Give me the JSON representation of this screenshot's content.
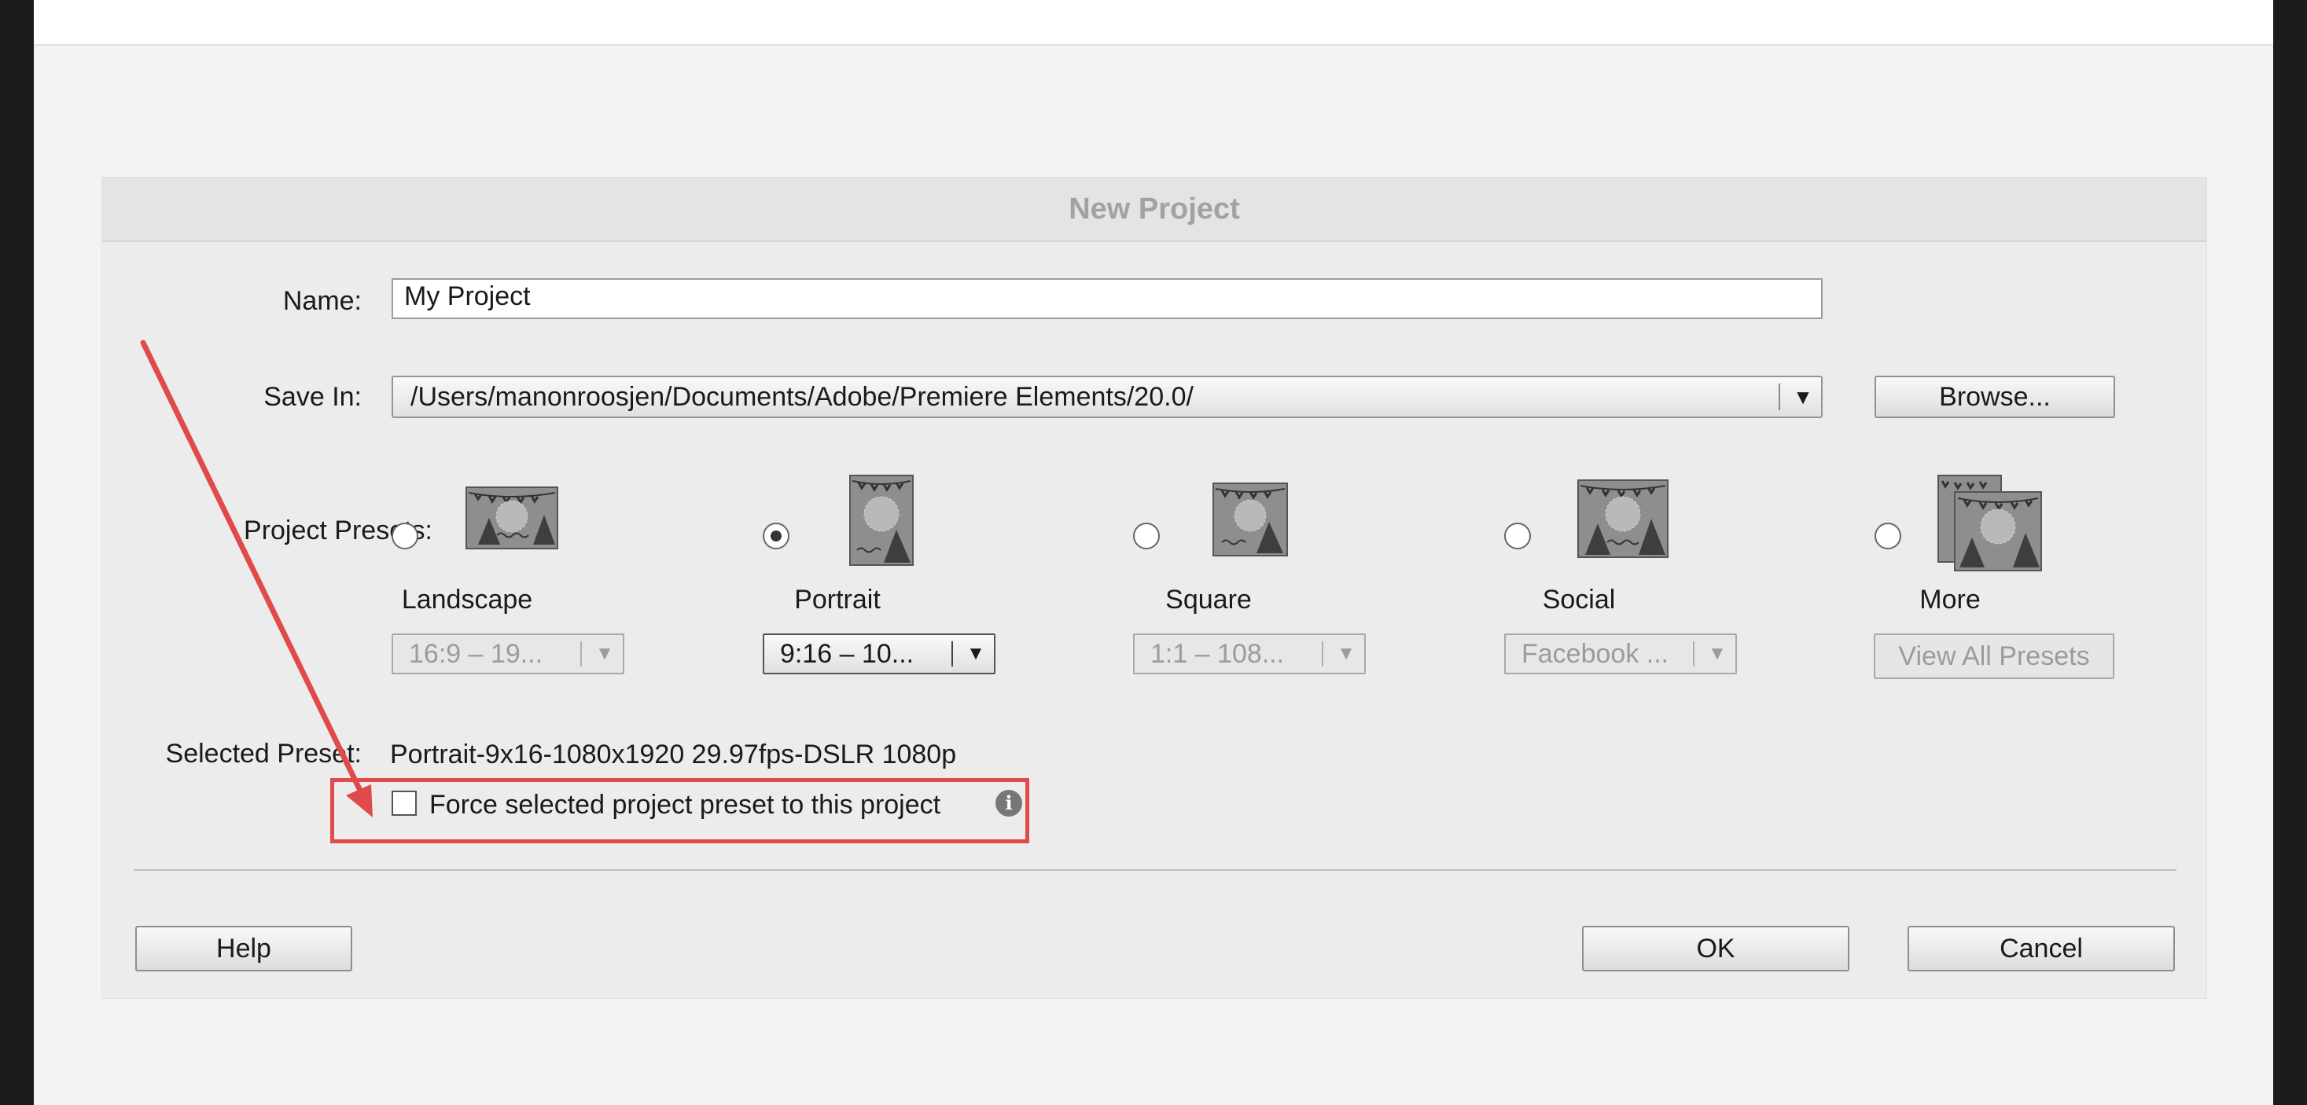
{
  "dialog": {
    "title": "New Project",
    "name_label": "Name:",
    "name_value": "My Project",
    "save_in_label": "Save In:",
    "save_in_value": "/Users/manonroosjen/Documents/Adobe/Premiere Elements/20.0/",
    "browse_label": "Browse...",
    "presets_label": "Project Presets:",
    "presets": [
      {
        "label": "Landscape",
        "option": "16:9 – 19...",
        "selected": false,
        "active": false
      },
      {
        "label": "Portrait",
        "option": "9:16 – 10...",
        "selected": true,
        "active": true
      },
      {
        "label": "Square",
        "option": "1:1 – 108...",
        "selected": false,
        "active": false
      },
      {
        "label": "Social",
        "option": "Facebook ...",
        "selected": false,
        "active": false
      },
      {
        "label": "More",
        "option": "View All Presets",
        "selected": false,
        "active": false
      }
    ],
    "selected_preset_label": "Selected Preset:",
    "selected_preset_value": "Portrait-9x16-1080x1920 29.97fps-DSLR 1080p",
    "force_checkbox_label": "Force selected project preset to this project",
    "force_checkbox_checked": false,
    "help_label": "Help",
    "ok_label": "OK",
    "cancel_label": "Cancel"
  },
  "icons": {
    "dropdown_arrow": "▼",
    "info": "i"
  },
  "colors": {
    "annotation_red": "#e04a4a",
    "title_text": "#a2a2a2"
  }
}
